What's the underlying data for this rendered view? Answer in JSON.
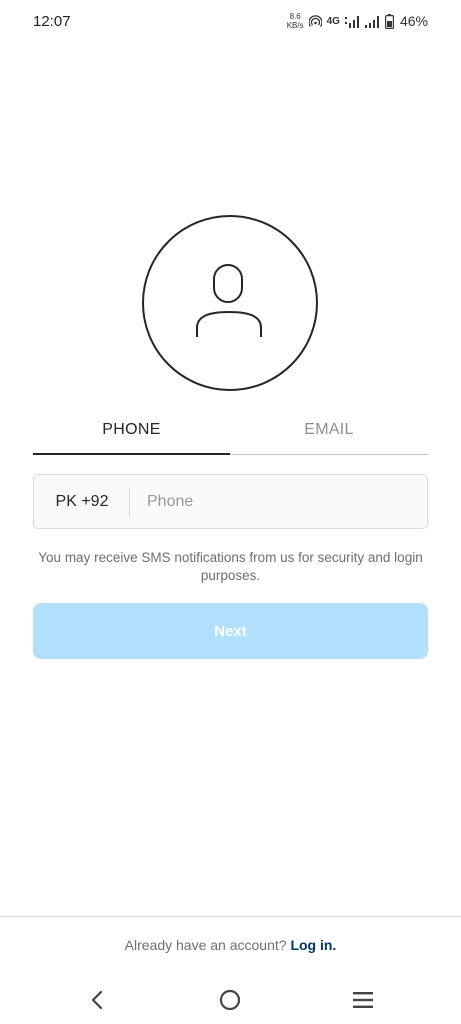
{
  "status_bar": {
    "time": "12:07",
    "net_speed_value": "8.6",
    "net_speed_unit": "KB/s",
    "network": "4G",
    "battery": "46%",
    "icons": [
      "hotspot-icon",
      "signal-icon",
      "battery-icon"
    ]
  },
  "avatar": {
    "icon": "user-icon"
  },
  "tabs": [
    {
      "label": "PHONE",
      "active": true
    },
    {
      "label": "EMAIL",
      "active": false
    }
  ],
  "phone_field": {
    "country_code": "PK +92",
    "placeholder": "Phone",
    "value": ""
  },
  "notice": "You may receive SMS notifications from us for security and login purposes.",
  "next_button": {
    "label": "Next",
    "enabled": false
  },
  "footer": {
    "prompt": "Already have an account?",
    "link": "Log in."
  },
  "nav_bar": {
    "icons": [
      "back-icon",
      "home-icon",
      "recents-icon"
    ]
  },
  "colors": {
    "accent_disabled": "#b2dffc",
    "link": "#00376b",
    "text_primary": "#262626",
    "text_secondary": "#8e8e8e"
  }
}
